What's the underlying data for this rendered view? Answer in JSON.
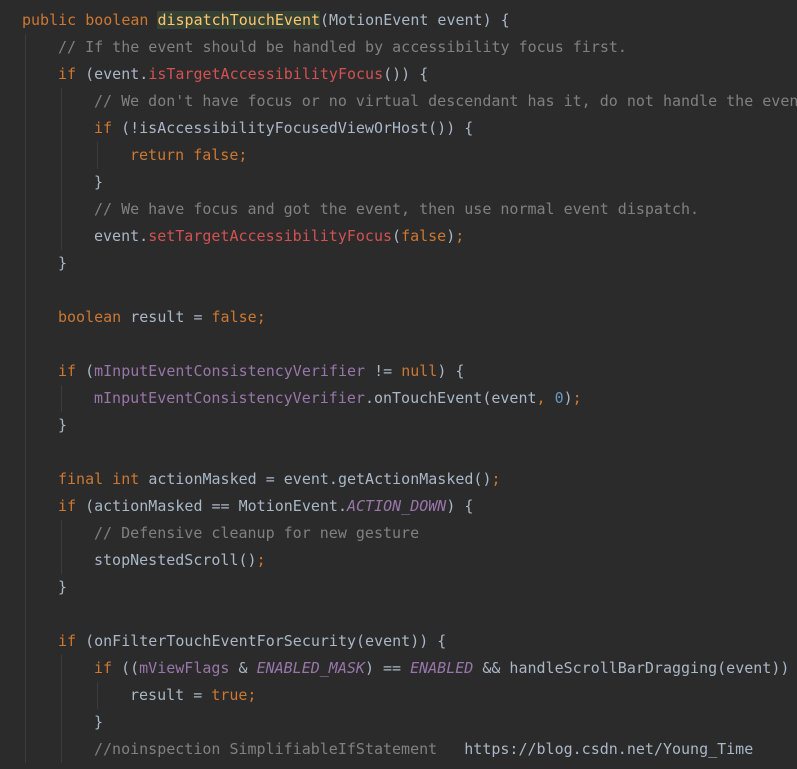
{
  "editor": {
    "theme_colors": {
      "background": "#2b2b2b",
      "keyword": "#cc7832",
      "plain": "#a9b7c6",
      "method_declaration": "#ffc66d",
      "field": "#9876aa",
      "comment": "#808080",
      "number": "#6897bb"
    },
    "lines": [
      {
        "indent": 0,
        "tokens": [
          {
            "t": "public boolean ",
            "c": "kw"
          },
          {
            "t": "dispatchTouchEvent",
            "c": "method-hl"
          },
          {
            "t": "(MotionEvent event) {",
            "c": "plain"
          }
        ]
      },
      {
        "indent": 1,
        "tokens": [
          {
            "t": "// If the event should be handled by accessibility focus first.",
            "c": "comment"
          }
        ]
      },
      {
        "indent": 1,
        "tokens": [
          {
            "t": "if ",
            "c": "kw"
          },
          {
            "t": "(event.",
            "c": "plain"
          },
          {
            "t": "isTargetAccessibilityFocus",
            "c": "call-red"
          },
          {
            "t": "()) {",
            "c": "plain"
          }
        ]
      },
      {
        "indent": 2,
        "tokens": [
          {
            "t": "// We don't have focus or no virtual descendant has it, do not handle the event.",
            "c": "comment"
          }
        ]
      },
      {
        "indent": 2,
        "tokens": [
          {
            "t": "if ",
            "c": "kw"
          },
          {
            "t": "(!isAccessibilityFocusedViewOrHost()) {",
            "c": "plain"
          }
        ]
      },
      {
        "indent": 3,
        "tokens": [
          {
            "t": "return false",
            "c": "kw"
          },
          {
            "t": ";",
            "c": "punct"
          }
        ]
      },
      {
        "indent": 2,
        "tokens": [
          {
            "t": "}",
            "c": "plain"
          }
        ]
      },
      {
        "indent": 2,
        "tokens": [
          {
            "t": "// We have focus and got the event, then use normal event dispatch.",
            "c": "comment"
          }
        ]
      },
      {
        "indent": 2,
        "tokens": [
          {
            "t": "event.",
            "c": "plain"
          },
          {
            "t": "setTargetAccessibilityFocus",
            "c": "call-red"
          },
          {
            "t": "(",
            "c": "plain"
          },
          {
            "t": "false",
            "c": "kw"
          },
          {
            "t": ")",
            "c": "plain"
          },
          {
            "t": ";",
            "c": "punct"
          }
        ]
      },
      {
        "indent": 1,
        "tokens": [
          {
            "t": "}",
            "c": "plain"
          }
        ]
      },
      {
        "indent": 0,
        "tokens": []
      },
      {
        "indent": 1,
        "tokens": [
          {
            "t": "boolean ",
            "c": "kw"
          },
          {
            "t": "result = ",
            "c": "plain"
          },
          {
            "t": "false",
            "c": "kw"
          },
          {
            "t": ";",
            "c": "punct"
          }
        ]
      },
      {
        "indent": 0,
        "tokens": []
      },
      {
        "indent": 1,
        "tokens": [
          {
            "t": "if ",
            "c": "kw"
          },
          {
            "t": "(",
            "c": "plain"
          },
          {
            "t": "mInputEventConsistencyVerifier",
            "c": "field"
          },
          {
            "t": " != ",
            "c": "plain"
          },
          {
            "t": "null",
            "c": "kw"
          },
          {
            "t": ") {",
            "c": "plain"
          }
        ]
      },
      {
        "indent": 2,
        "tokens": [
          {
            "t": "mInputEventConsistencyVerifier",
            "c": "field"
          },
          {
            "t": ".onTouchEvent(event",
            "c": "plain"
          },
          {
            "t": ", ",
            "c": "punct"
          },
          {
            "t": "0",
            "c": "number"
          },
          {
            "t": ")",
            "c": "plain"
          },
          {
            "t": ";",
            "c": "punct"
          }
        ]
      },
      {
        "indent": 1,
        "tokens": [
          {
            "t": "}",
            "c": "plain"
          }
        ]
      },
      {
        "indent": 0,
        "tokens": []
      },
      {
        "indent": 1,
        "tokens": [
          {
            "t": "final int ",
            "c": "kw"
          },
          {
            "t": "actionMasked = event.getActionMasked()",
            "c": "plain"
          },
          {
            "t": ";",
            "c": "punct"
          }
        ]
      },
      {
        "indent": 1,
        "tokens": [
          {
            "t": "if ",
            "c": "kw"
          },
          {
            "t": "(actionMasked == MotionEvent.",
            "c": "plain"
          },
          {
            "t": "ACTION_DOWN",
            "c": "static"
          },
          {
            "t": ") {",
            "c": "plain"
          }
        ]
      },
      {
        "indent": 2,
        "tokens": [
          {
            "t": "// Defensive cleanup for new gesture",
            "c": "comment"
          }
        ]
      },
      {
        "indent": 2,
        "tokens": [
          {
            "t": "stopNestedScroll()",
            "c": "plain"
          },
          {
            "t": ";",
            "c": "punct"
          }
        ]
      },
      {
        "indent": 1,
        "tokens": [
          {
            "t": "}",
            "c": "plain"
          }
        ]
      },
      {
        "indent": 0,
        "tokens": []
      },
      {
        "indent": 1,
        "tokens": [
          {
            "t": "if ",
            "c": "kw"
          },
          {
            "t": "(onFilterTouchEventForSecurity(event)) {",
            "c": "plain"
          }
        ]
      },
      {
        "indent": 2,
        "tokens": [
          {
            "t": "if ",
            "c": "kw"
          },
          {
            "t": "((",
            "c": "plain"
          },
          {
            "t": "mViewFlags",
            "c": "field"
          },
          {
            "t": " & ",
            "c": "plain"
          },
          {
            "t": "ENABLED_MASK",
            "c": "static"
          },
          {
            "t": ") == ",
            "c": "plain"
          },
          {
            "t": "ENABLED",
            "c": "static"
          },
          {
            "t": " && handleScrollBarDragging(event)) {",
            "c": "plain"
          }
        ]
      },
      {
        "indent": 3,
        "tokens": [
          {
            "t": "result = ",
            "c": "plain"
          },
          {
            "t": "true",
            "c": "kw"
          },
          {
            "t": ";",
            "c": "punct"
          }
        ]
      },
      {
        "indent": 2,
        "tokens": [
          {
            "t": "}",
            "c": "plain"
          }
        ]
      },
      {
        "indent": 2,
        "tokens": [
          {
            "t": "//noinspection SimplifiableIfStatement",
            "c": "comment"
          },
          {
            "t": "   https://blog.csdn.net/Young_Time",
            "c": "url"
          }
        ]
      }
    ]
  }
}
